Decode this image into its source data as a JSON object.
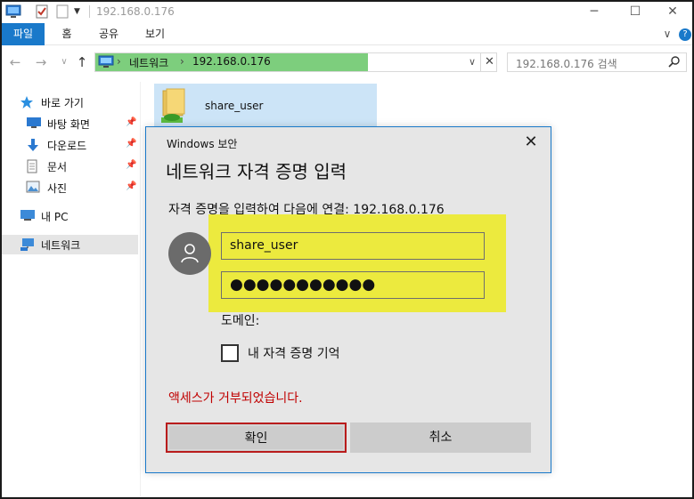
{
  "window": {
    "title": "192.168.0.176",
    "minimize_glyph": "─",
    "maximize_glyph": "☐",
    "close_glyph": "✕"
  },
  "ribbon": {
    "tabs": [
      {
        "label": "파일",
        "active": true
      },
      {
        "label": "홈"
      },
      {
        "label": "공유"
      },
      {
        "label": "보기"
      }
    ],
    "collapse_glyph": "∨",
    "help_glyph": "?"
  },
  "address": {
    "back_glyph": "←",
    "forward_glyph": "→",
    "recent_glyph": "∨",
    "up_glyph": "↑",
    "crumbs": [
      "네트워크",
      "192.168.0.176"
    ],
    "sep_glyph": "›",
    "dropdown_glyph": "∨",
    "clear_glyph": "✕",
    "highlight_color": "#7dce7d"
  },
  "search": {
    "placeholder": "192.168.0.176 검색",
    "icon": "search-icon"
  },
  "sidebar": {
    "items": [
      {
        "label": "바로 가기",
        "icon": "star-icon"
      },
      {
        "label": "바탕 화면",
        "icon": "desktop-icon",
        "pinned": true
      },
      {
        "label": "다운로드",
        "icon": "download-icon",
        "pinned": true
      },
      {
        "label": "문서",
        "icon": "document-icon",
        "pinned": true
      },
      {
        "label": "사진",
        "icon": "pictures-icon",
        "pinned": true
      },
      {
        "label": "내 PC",
        "icon": "pc-icon"
      },
      {
        "label": "네트워크",
        "icon": "network-icon",
        "selected": true
      }
    ],
    "pin_glyph": "📌"
  },
  "content": {
    "items": [
      {
        "label": "share_user",
        "icon": "shared-folder-icon"
      }
    ]
  },
  "dialog": {
    "caption": "Windows 보안",
    "close_glyph": "✕",
    "heading": "네트워크 자격 증명 입력",
    "connect_text": "자격 증명을 입력하여 다음에 연결: 192.168.0.176",
    "username": "share_user",
    "password_mask": "●●●●●●●●●●●",
    "domain_label": "도메인:",
    "remember_label": "내 자격 증명 기억",
    "remember_checked": false,
    "error": "액세스가 거부되었습니다.",
    "ok_label": "확인",
    "cancel_label": "취소",
    "highlight_color": "#ecea3e",
    "error_color": "#c00000",
    "accent_color": "#1979ca"
  }
}
